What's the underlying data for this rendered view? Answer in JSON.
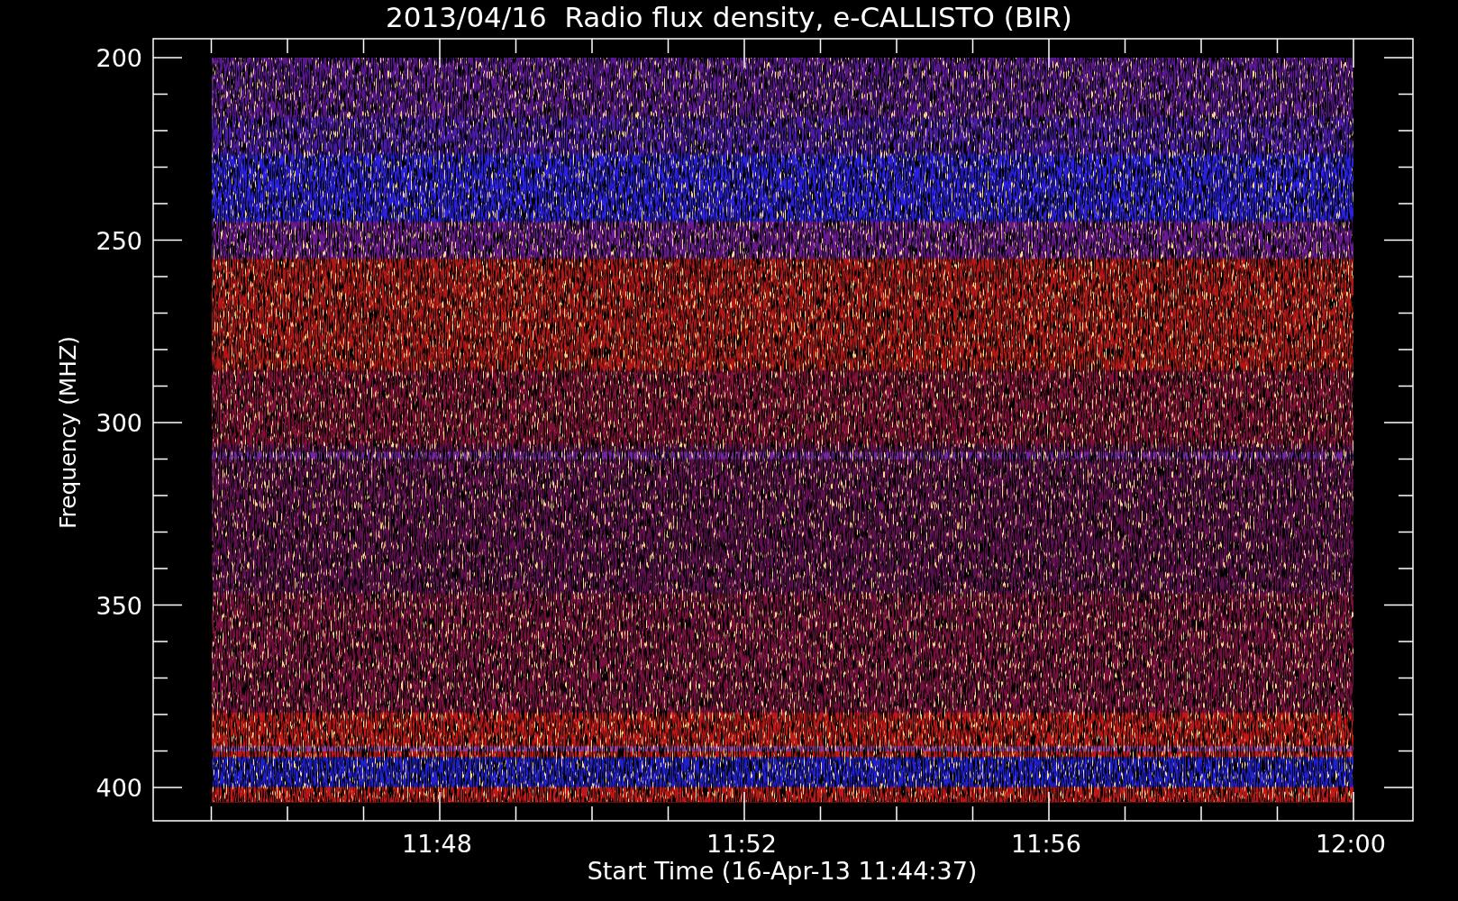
{
  "title": "2013/04/16  Radio flux density, e-CALLISTO (BIR)",
  "y_axis": {
    "label": "Frequency (MHZ)",
    "ticks": [
      "200",
      "250",
      "300",
      "350",
      "400"
    ]
  },
  "x_axis": {
    "label": "Start Time (16-Apr-13 11:44:37)",
    "ticks": [
      "11:48",
      "11:52",
      "11:56",
      "12:00"
    ]
  }
}
